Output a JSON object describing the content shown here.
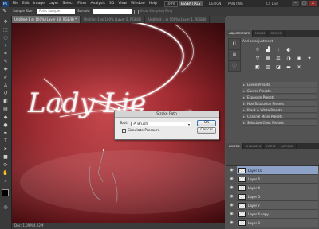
{
  "menubar": {
    "logo": "Ps",
    "items": [
      "File",
      "Edit",
      "Image",
      "Layer",
      "Select",
      "Filter",
      "Analysis",
      "3D",
      "View",
      "Window",
      "Help"
    ],
    "zoom": "100%",
    "workspace_active": "ESSENTIALS",
    "workspace_others": [
      "DESIGN",
      "PAINTING"
    ],
    "cs_live": "CS Live"
  },
  "options": {
    "sample_size_label": "Sample Size:",
    "sample_size_value": "Point Sample",
    "sample_label": "Sample:",
    "show_ring": "Show Sampling Ring"
  },
  "tabs": [
    {
      "label": "Untitled-1 @ 100% (Layer 10, RGB/8) *",
      "active": true
    },
    {
      "label": "Untitled-1 @ 100% (Layer 8, RGB/8)",
      "active": false
    },
    {
      "label": "Untitled-1 @ 100% (Layer 1, RGB/8)",
      "active": false
    }
  ],
  "canvas": {
    "script_text": "Lady Lie"
  },
  "status": {
    "text": "Doc: 1.09M/4.22M"
  },
  "dialog": {
    "title": "Stroke Path",
    "tool_label": "Tool:",
    "tool_value": "Brush",
    "simulate_pressure": "Simulate Pressure",
    "ok": "OK",
    "cancel": "Cancel"
  },
  "adjustments": {
    "tabs": [
      "ADJUSTMENTS",
      "MASKS",
      "STYLES"
    ],
    "title": "Add an adjustment",
    "presets": [
      "Levels Presets",
      "Curves Presets",
      "Exposure Presets",
      "Hue/Saturation Presets",
      "Black & White Presets",
      "Channel Mixer Presets",
      "Selective Color Presets"
    ]
  },
  "layers": {
    "tabs": [
      "LAYERS",
      "CHANNELS",
      "PATHS",
      "ACTIONS"
    ],
    "items": [
      "Layer 10",
      "Layer 6",
      "Layer 4",
      "Layer 5",
      "Layer 7",
      "Layer 4 copy",
      "Layer 3"
    ],
    "selected_index": 0
  },
  "colors": {
    "canvas_dark": "#5e0f14",
    "canvas_mid": "#b23a40",
    "layer_selected": "#8da2c6"
  }
}
